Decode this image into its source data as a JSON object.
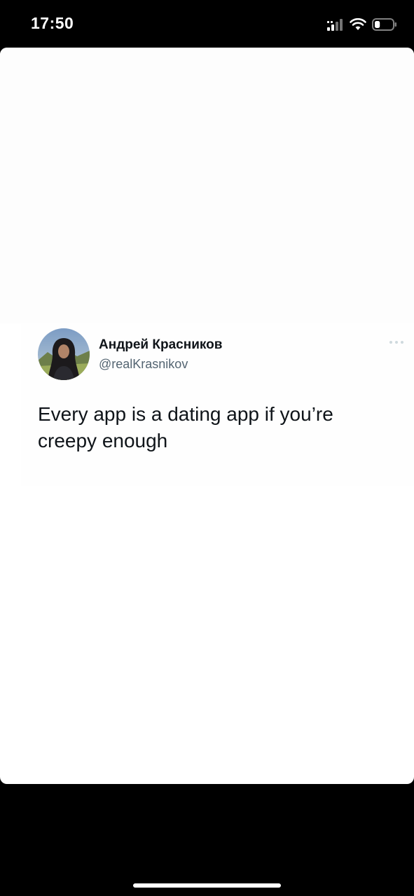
{
  "status_bar": {
    "time": "17:50",
    "icons": [
      "cellular-signal-icon",
      "wifi-icon",
      "battery-icon"
    ],
    "battery_level": 0.3
  },
  "tweet": {
    "display_name": "Андрей Красников",
    "handle": "@realKrasnikov",
    "text": "Every app is a dating app if you’re creepy enough",
    "more_icon": "more-dots-icon",
    "avatar_icon": "profile-photo"
  },
  "colors": {
    "background": "#000000",
    "sheet": "#ffffff",
    "name_text": "#0f1419",
    "handle_text": "#536471",
    "more_dots": "#cfd9de"
  }
}
